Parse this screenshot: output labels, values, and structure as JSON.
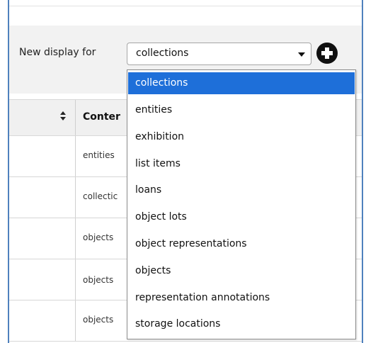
{
  "toolbar": {
    "new_display_label": "New display for",
    "selected_value": "collections"
  },
  "table": {
    "header": {
      "content_label": "Conter"
    },
    "rows": [
      {
        "content": "entities"
      },
      {
        "content": "collectic"
      },
      {
        "content": "objects"
      },
      {
        "content": "objects"
      },
      {
        "content": "objects"
      }
    ]
  },
  "dropdown": {
    "options": [
      "collections",
      "entities",
      "exhibition",
      "list items",
      "loans",
      "object lots",
      "object representations",
      "objects",
      "representation annotations",
      "storage locations"
    ],
    "selected_index": 0
  },
  "colors": {
    "selected_option_bg": "#1e6fd9",
    "frame_border": "#4f81bd",
    "toolbar_bg": "#f2f2f2"
  },
  "icons": {
    "add": "plus-circle-icon",
    "sort": "sort-arrows-icon",
    "caret": "chevron-down-icon"
  }
}
